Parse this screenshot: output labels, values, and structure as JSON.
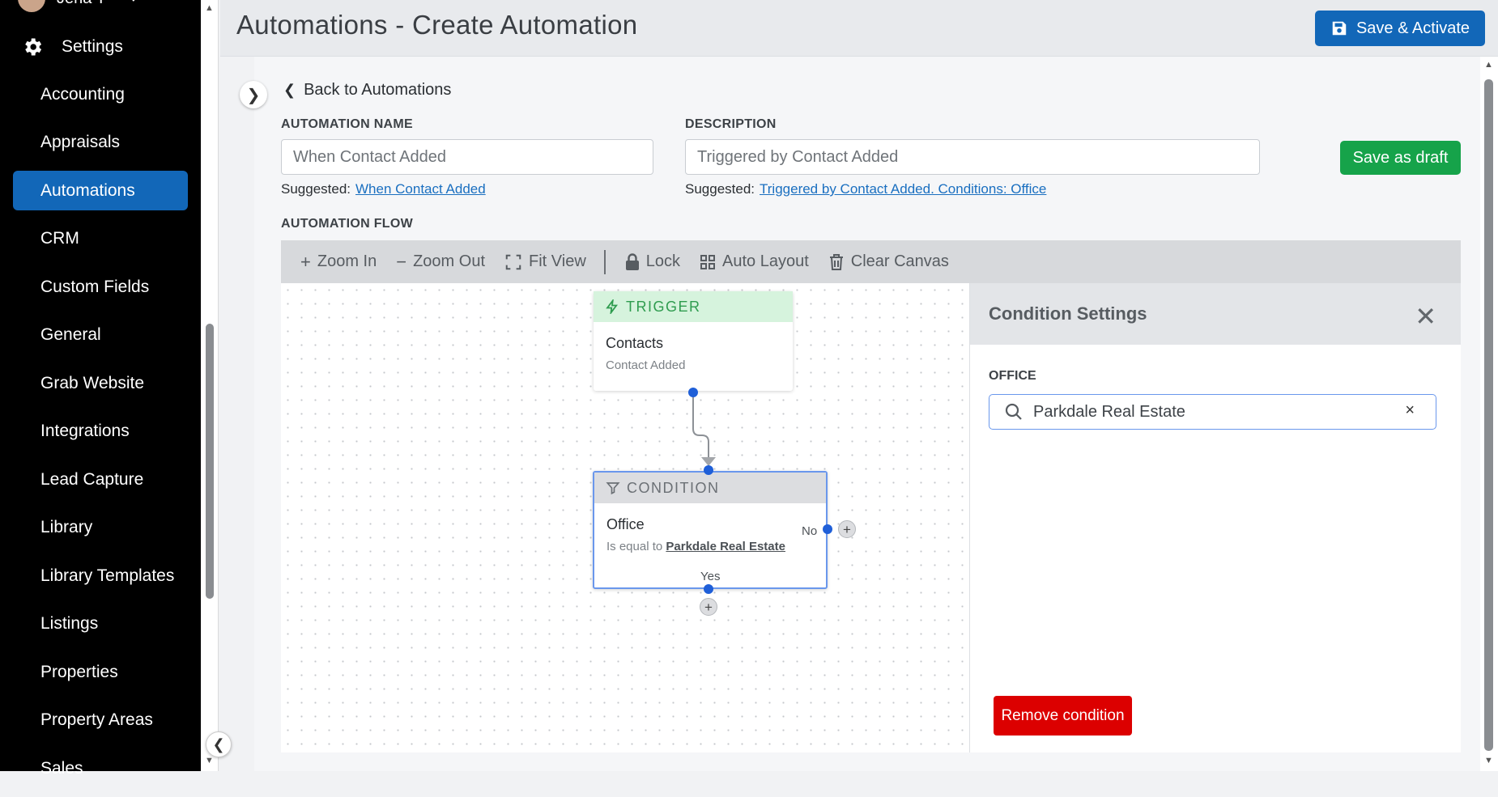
{
  "sidebar": {
    "user_name": "Jena T",
    "settings_label": "Settings",
    "items": [
      {
        "label": "Accounting"
      },
      {
        "label": "Appraisals"
      },
      {
        "label": "Automations"
      },
      {
        "label": "CRM"
      },
      {
        "label": "Custom Fields"
      },
      {
        "label": "General"
      },
      {
        "label": "Grab Website"
      },
      {
        "label": "Integrations"
      },
      {
        "label": "Lead Capture"
      },
      {
        "label": "Library"
      },
      {
        "label": "Library Templates"
      },
      {
        "label": "Listings"
      },
      {
        "label": "Properties"
      },
      {
        "label": "Property Areas"
      },
      {
        "label": "Sales"
      }
    ],
    "active_item": "Automations"
  },
  "header": {
    "title": "Automations - Create Automation",
    "save_activate_label": "Save & Activate"
  },
  "form": {
    "back_label": "Back to Automations",
    "name_label": "AUTOMATION NAME",
    "name_value": "When Contact Added",
    "name_suggested_prefix": "Suggested:",
    "name_suggested_link": "When Contact Added",
    "description_label": "DESCRIPTION",
    "description_value": "Triggered by Contact Added",
    "description_suggested_prefix": "Suggested:",
    "description_suggested_link": "Triggered by Contact Added. Conditions: Office",
    "save_draft_label": "Save as draft",
    "flow_label": "AUTOMATION FLOW"
  },
  "toolbar": {
    "zoom_in": "Zoom In",
    "zoom_out": "Zoom Out",
    "fit_view": "Fit View",
    "lock": "Lock",
    "auto_layout": "Auto Layout",
    "clear_canvas": "Clear Canvas"
  },
  "flow": {
    "trigger": {
      "header": "TRIGGER",
      "title": "Contacts",
      "subtitle": "Contact Added"
    },
    "condition": {
      "header": "CONDITION",
      "title": "Office",
      "operator": "Is equal to",
      "value": "Parkdale Real Estate",
      "no_label": "No",
      "yes_label": "Yes"
    }
  },
  "panel": {
    "title": "Condition Settings",
    "office_label": "OFFICE",
    "office_value": "Parkdale Real Estate",
    "remove_label": "Remove condition"
  },
  "colors": {
    "primary": "#1267b8",
    "draft_green": "#16a34a",
    "remove_red": "#dc0000",
    "trigger_bg": "#d6f3dd"
  }
}
